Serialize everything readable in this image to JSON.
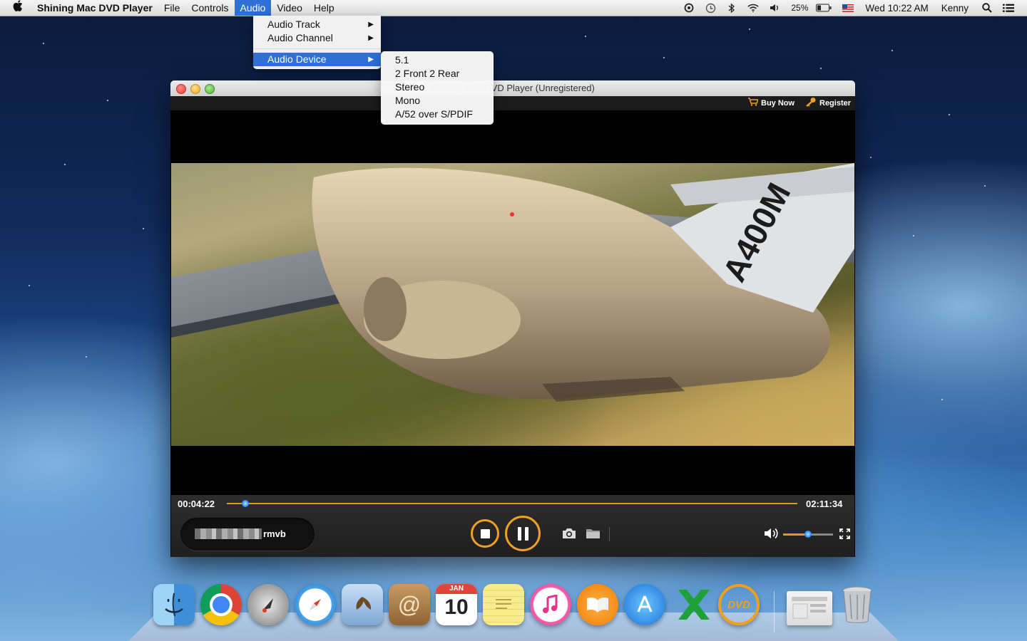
{
  "menubar": {
    "app_name": "Shining Mac DVD Player",
    "menus": [
      "File",
      "Controls",
      "Audio",
      "Video",
      "Help"
    ],
    "battery": "25%",
    "clock": "Wed 10:22 AM",
    "user": "Kenny"
  },
  "audio_menu": {
    "items": [
      "Audio Track",
      "Audio Channel",
      "Audio Device"
    ]
  },
  "audio_device_submenu": {
    "items": [
      "5.1",
      "2 Front 2 Rear",
      "Stereo",
      "Mono",
      "A/52 over S/PDIF"
    ]
  },
  "window": {
    "title": "Shining Mac DVD Player (Unregistered)",
    "buy_now": "Buy Now",
    "register": "Register"
  },
  "video": {
    "tail_text": "A400M"
  },
  "player": {
    "elapsed": "00:04:22",
    "duration": "02:11:34",
    "progress": 0.033,
    "volume": 0.5,
    "file_ext": "rmvb"
  },
  "colors": {
    "accent": "#f0a020",
    "selection": "#2f6fd6"
  },
  "dock": {
    "items": [
      "finder",
      "chrome",
      "launchpad",
      "safari",
      "mail",
      "contacts",
      "calendar",
      "notes",
      "itunes",
      "ibooks",
      "app-store",
      "excel",
      "dvd-player",
      "preview",
      "trash"
    ],
    "calendar_month": "JAN",
    "calendar_day": "10",
    "dvd_label": "DVD"
  }
}
